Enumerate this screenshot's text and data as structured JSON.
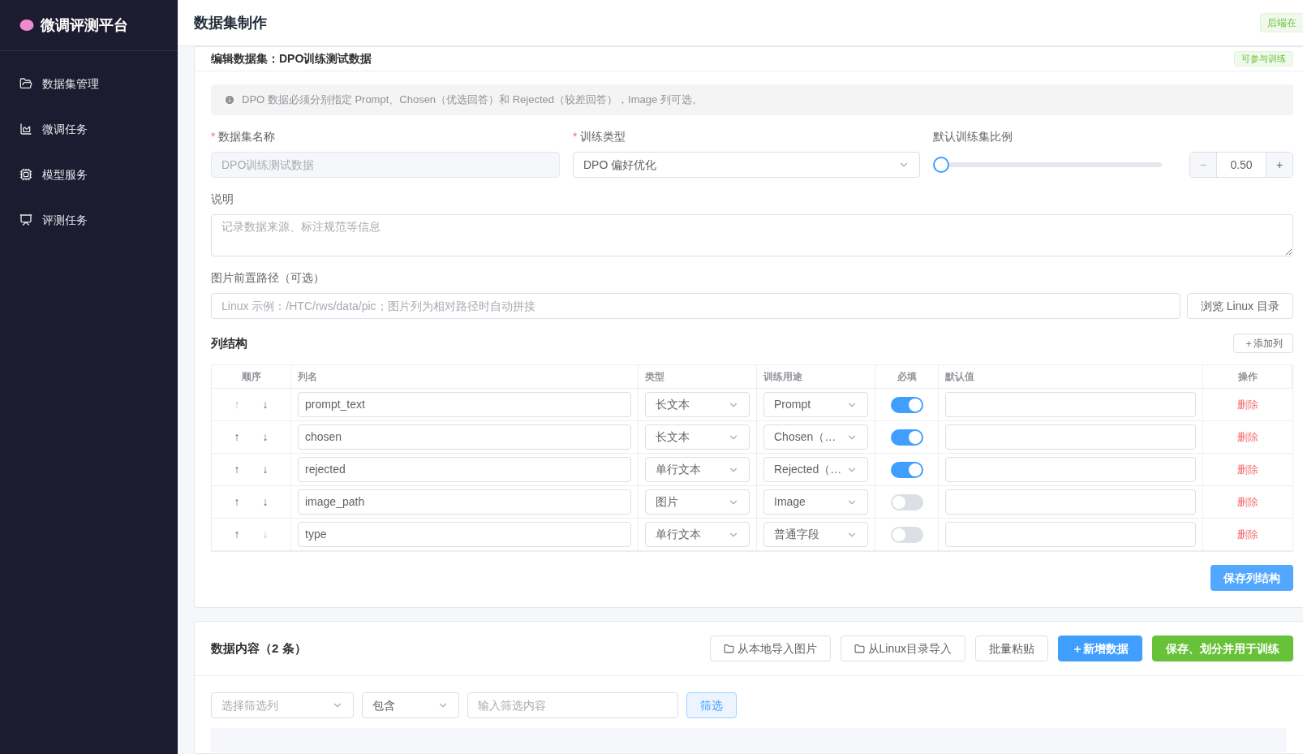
{
  "sidebar": {
    "logo": "微调评测平台",
    "items": [
      {
        "label": "数据集管理",
        "selected": false
      },
      {
        "label": "微调任务",
        "selected": false
      },
      {
        "label": "模型服务",
        "selected": false
      },
      {
        "label": "评测任务",
        "selected": false
      }
    ]
  },
  "header": {
    "title": "数据集制作",
    "badge": "后端在"
  },
  "editor": {
    "title": "编辑数据集：DPO训练测试数据",
    "tag": "可参与训练",
    "info": "DPO 数据必须分别指定 Prompt、Chosen（优选回答）和 Rejected（较差回答），Image 列可选。",
    "name_label": "数据集名称",
    "name_mark": "*",
    "name_value": "DPO训练测试数据",
    "type_label": "训练类型",
    "type_mark": "*",
    "type_value": "DPO 偏好优化",
    "ratio_label": "默认训练集比例",
    "ratio": {
      "level": 0,
      "minus": "−",
      "value": "0.50",
      "plus": "+"
    },
    "desc_label": "说明",
    "desc_placeholder": "记录数据来源、标注规范等信息",
    "path_label": "图片前置路径（可选）",
    "path_placeholder": "Linux 示例：/HTC/rws/data/pic；图片列为相对路径时自动拼接",
    "browse": "浏览 Linux 目录",
    "columns_title": "列结构",
    "add_column": "＋添加列",
    "table_headers": [
      "顺序",
      "列名",
      "类型",
      "训练用途",
      "必填",
      "默认值",
      "操作"
    ],
    "rows": [
      {
        "up": "↑",
        "up_disabled": true,
        "down": "↓",
        "down_disabled": false,
        "name": "prompt_text",
        "type": "长文本",
        "usage": "Prompt",
        "required": true,
        "action": "删除"
      },
      {
        "up": "↑",
        "up_disabled": false,
        "down": "↓",
        "down_disabled": false,
        "name": "chosen",
        "type": "长文本",
        "usage": "Chosen（…",
        "required": true,
        "action": "删除"
      },
      {
        "up": "↑",
        "up_disabled": false,
        "down": "↓",
        "down_disabled": false,
        "name": "rejected",
        "type": "单行文本",
        "usage": "Rejected（…",
        "required": true,
        "action": "删除"
      },
      {
        "up": "↑",
        "up_disabled": false,
        "down": "↓",
        "down_disabled": false,
        "name": "image_path",
        "type": "图片",
        "usage": "Image",
        "required": false,
        "action": "删除"
      },
      {
        "up": "↑",
        "up_disabled": false,
        "down": "↓",
        "down_disabled": true,
        "name": "type",
        "type": "单行文本",
        "usage": "普通字段",
        "required": false,
        "action": "删除"
      }
    ],
    "save_columns": "保存列结构"
  },
  "content": {
    "title": "数据内容（2 条）",
    "buttons": [
      {
        "label": "从本地导入图片",
        "kind": "folder"
      },
      {
        "label": "从Linux目录导入",
        "kind": "folder"
      },
      {
        "label": "批量粘贴",
        "kind": "plain"
      },
      {
        "label": "＋新增数据",
        "kind": "primary"
      },
      {
        "label": "保存、划分并用于训练",
        "kind": "success"
      }
    ],
    "filter_column_placeholder": "选择筛选列",
    "filter_op": "包含",
    "filter_placeholder": "输入筛选内容",
    "filter_button": "筛选"
  }
}
